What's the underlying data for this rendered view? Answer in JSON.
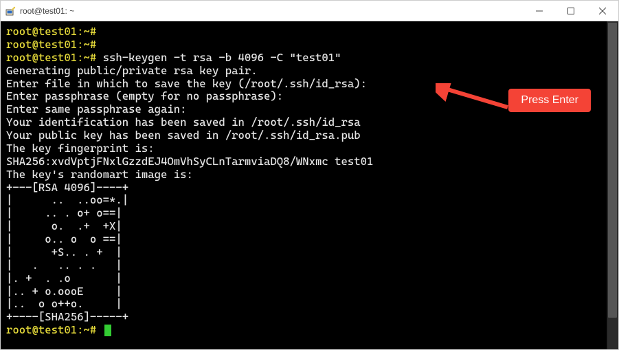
{
  "window": {
    "title": "root@test01: ~"
  },
  "annotation": {
    "label": "Press Enter"
  },
  "terminal": {
    "prompt": "root@test01:~#",
    "command": "ssh-keygen -t rsa -b 4096 -C \"test01\"",
    "lines": [
      "Generating public/private rsa key pair.",
      "Enter file in which to save the key (/root/.ssh/id_rsa):",
      "Enter passphrase (empty for no passphrase):",
      "Enter same passphrase again:",
      "Your identification has been saved in /root/.ssh/id_rsa",
      "Your public key has been saved in /root/.ssh/id_rsa.pub",
      "The key fingerprint is:",
      "SHA256:xvdVptjFNxlGzzdEJ4OmVhSyCLnTarmviaDQ8/WNxmc test01",
      "The key's randomart image is:",
      "+---[RSA 4096]----+",
      "|      ..  ..oo=*.|",
      "|     .. . o+ o==|",
      "|      o.  .+  +X|",
      "|     o.. o  o ==|",
      "|      +S.. . +  |",
      "|   .   .. . .   |",
      "|. +  . .o       |",
      "|.. + o.oooE     |",
      "|..  o o++o.     |",
      "+----[SHA256]-----+"
    ]
  }
}
